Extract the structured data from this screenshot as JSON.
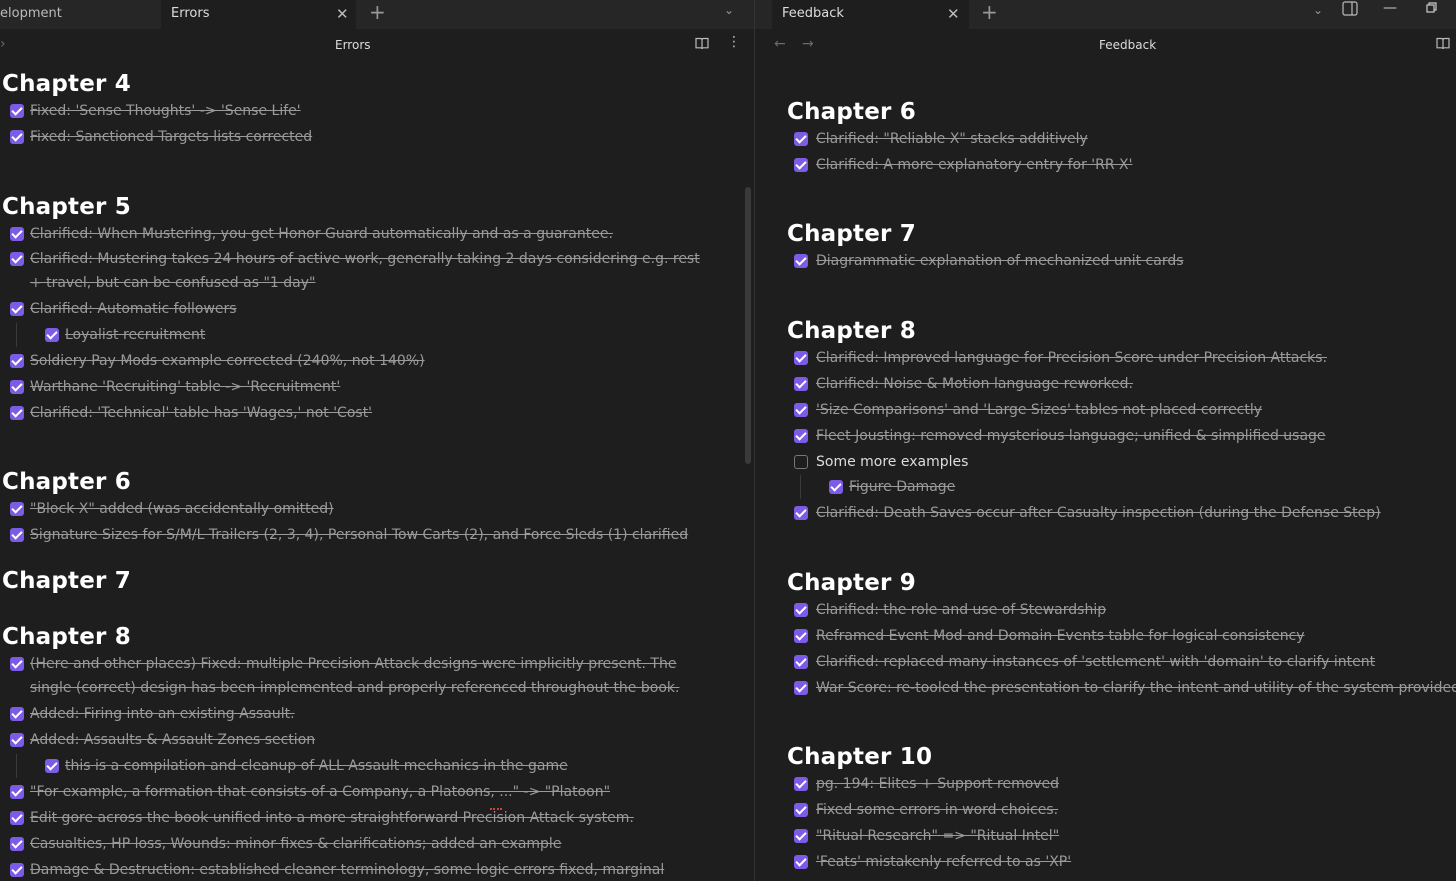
{
  "left": {
    "tabs": [
      {
        "label": "elopment",
        "active": false
      },
      {
        "label": "Errors",
        "active": true
      }
    ],
    "view_title": "Errors",
    "sections": [
      {
        "heading": "Chapter 4",
        "items": [
          {
            "text": "Fixed: 'Sense Thoughts' -> 'Sense Life'",
            "checked": true
          },
          {
            "text": "Fixed: Sanctioned Targets lists corrected",
            "checked": true
          }
        ]
      },
      {
        "heading": "Chapter 5",
        "items": [
          {
            "text": "Clarified: When Mustering, you get Honor Guard automatically and as a guarantee.",
            "checked": true
          },
          {
            "text": "Clarified: Mustering takes 24 hours of active work, generally taking 2 days considering e.g. rest",
            "text2": "+ travel, but can be confused as \"1 day\"",
            "checked": true
          },
          {
            "text": "Clarified: Automatic followers",
            "checked": true
          },
          {
            "text": "Loyalist recruitment",
            "checked": true,
            "indent": true
          },
          {
            "text": "Soldiery Pay Mods example corrected (240%, not 140%)",
            "checked": true
          },
          {
            "text": "Warthane 'Recruiting' table -> 'Recruitment'",
            "checked": true
          },
          {
            "text": "Clarified: 'Technical' table has 'Wages,' not 'Cost'",
            "checked": true
          }
        ]
      },
      {
        "heading": "Chapter 6",
        "items": [
          {
            "text": "\"Block X\" added (was accidentally omitted)",
            "checked": true
          },
          {
            "text": "Signature Sizes for S/M/L Trailers (2, 3, 4), Personal Tow Carts (2), and Force Sleds (1) clarified",
            "checked": true
          }
        ]
      },
      {
        "heading": "Chapter 7",
        "items": []
      },
      {
        "heading": "Chapter 8",
        "items": [
          {
            "text": "(Here and other places) Fixed: multiple Precision Attack designs were implicitly present. The",
            "text2": "single (correct) design has been implemented and properly referenced throughout the book.",
            "checked": true
          },
          {
            "text": "Added: Firing into an existing Assault.",
            "checked": true
          },
          {
            "text": "Added: Assaults & Assault Zones section",
            "checked": true
          },
          {
            "text": "this is a compilation and cleanup of ALL Assault mechanics in the game",
            "checked": true,
            "indent": true
          },
          {
            "text": "\"For example, a formation that consists of a Company, a Platoons, ...\" -> \"Platoon\"",
            "checked": true
          },
          {
            "text": "Edit gore across the book unified into a more straightforward Precision Attack system.",
            "checked": true
          },
          {
            "text": "Casualties, HP loss, Wounds: minor fixes & clarifications; added an example",
            "checked": true
          },
          {
            "text": "Damage & Destruction: established cleaner terminology, some logic errors fixed, marginal",
            "checked": true
          }
        ]
      }
    ]
  },
  "right": {
    "tabs": [
      {
        "label": "Feedback",
        "active": true
      }
    ],
    "view_title": "Feedback",
    "sections": [
      {
        "heading": "Chapter 6",
        "items": [
          {
            "text": "Clarified: \"Reliable X\" stacks additively",
            "checked": true
          },
          {
            "text": "Clarified: A more explanatory entry for 'RR X'",
            "checked": true
          }
        ]
      },
      {
        "heading": "Chapter 7",
        "items": [
          {
            "text": "Diagrammatic explanation of mechanized unit cards",
            "checked": true
          }
        ]
      },
      {
        "heading": "Chapter 8",
        "items": [
          {
            "text": "Clarified: Improved language for Precision Score under Precision Attacks.",
            "checked": true
          },
          {
            "text": "Clarified: Noise & Motion language reworked.",
            "checked": true
          },
          {
            "text": "'Size Comparisons' and 'Large Sizes' tables not placed correctly",
            "checked": true
          },
          {
            "text": "Fleet Jousting: removed mysterious language; unified & simplified usage",
            "checked": true
          },
          {
            "text": "Some more examples",
            "checked": false
          },
          {
            "text": "Figure Damage",
            "checked": true,
            "indent": true
          },
          {
            "text": "Clarified: Death Saves occur after Casualty inspection (during the Defense Step)",
            "checked": true
          }
        ]
      },
      {
        "heading": "Chapter 9",
        "items": [
          {
            "text": "Clarified: the role and use of Stewardship",
            "checked": true
          },
          {
            "text": "Reframed Event Mod and Domain Events table for logical consistency",
            "checked": true
          },
          {
            "text": "Clarified: replaced many instances of 'settlement' with 'domain' to clarify intent",
            "checked": true
          },
          {
            "text": "War Score: re-tooled the presentation to clarify the intent and utility of the system provided",
            "checked": true
          }
        ]
      },
      {
        "heading": "Chapter 10",
        "items": [
          {
            "text": "pg. 194: Elites + Support removed",
            "checked": true
          },
          {
            "text": "Fixed some errors in word choices.",
            "checked": true
          },
          {
            "text": "\"Ritual Research\" => \"Ritual Intel\"",
            "checked": true
          },
          {
            "text": "'Feats' mistakenly referred to as 'XP'",
            "checked": true
          }
        ]
      }
    ]
  },
  "colors": {
    "background": "#1e1e1e",
    "checkbox_accent": "#7c5ce6",
    "heading": "#ffffff",
    "done_text": "#9a9a9a"
  }
}
